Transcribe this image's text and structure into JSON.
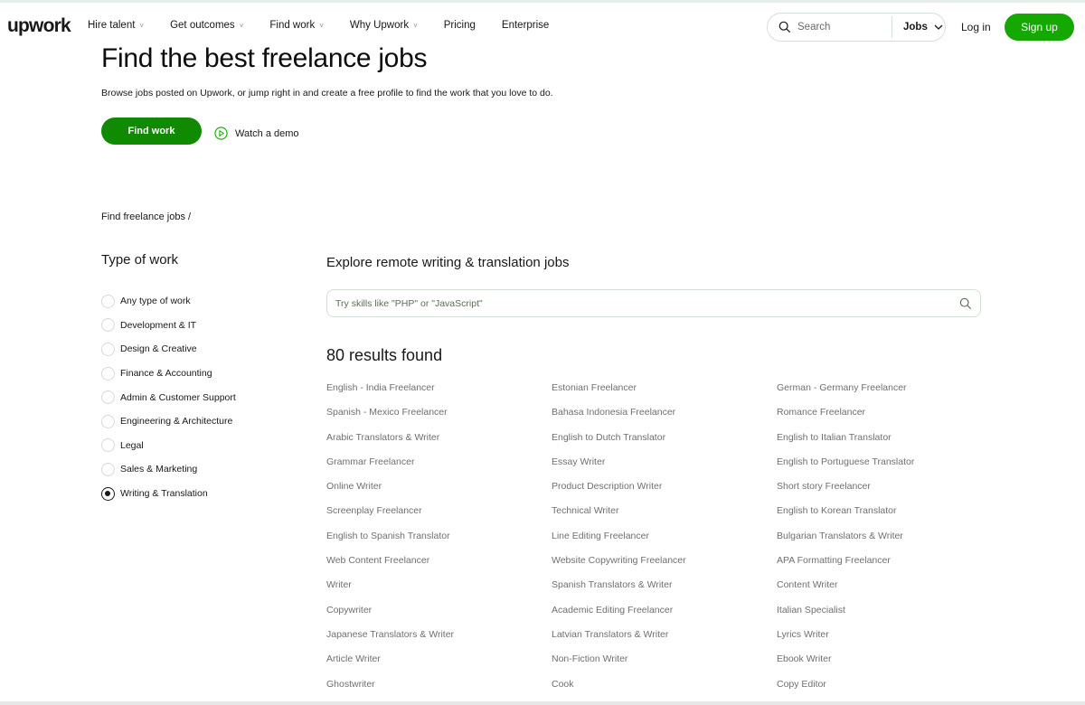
{
  "header": {
    "logo": "upwork",
    "nav": [
      {
        "label": "Hire talent",
        "dropdown": true
      },
      {
        "label": "Get outcomes",
        "dropdown": true
      },
      {
        "label": "Find work",
        "dropdown": true
      },
      {
        "label": "Why Upwork",
        "dropdown": true
      },
      {
        "label": "Pricing",
        "dropdown": false
      },
      {
        "label": "Enterprise",
        "dropdown": false
      }
    ],
    "search_placeholder": "Search",
    "search_scope": "Jobs",
    "login": "Log in",
    "signup": "Sign up"
  },
  "hero": {
    "title": "Find the best freelance jobs",
    "subtitle": "Browse jobs posted on Upwork, or jump right in and create a free profile to find the work that you love to do.",
    "find_work": "Find work",
    "watch_demo": "Watch a demo"
  },
  "breadcrumb": "Find freelance jobs /",
  "sidebar": {
    "title": "Type of work",
    "options": [
      {
        "label": "Any type of work",
        "selected": false
      },
      {
        "label": "Development & IT",
        "selected": false
      },
      {
        "label": "Design & Creative",
        "selected": false
      },
      {
        "label": "Finance & Accounting",
        "selected": false
      },
      {
        "label": "Admin & Customer Support",
        "selected": false
      },
      {
        "label": "Engineering & Architecture",
        "selected": false
      },
      {
        "label": "Legal",
        "selected": false
      },
      {
        "label": "Sales & Marketing",
        "selected": false
      },
      {
        "label": "Writing & Translation",
        "selected": true
      }
    ]
  },
  "main": {
    "title": "Explore remote writing & translation jobs",
    "skill_placeholder": "Try skills like \"PHP\" or \"JavaScript\"",
    "results": "80 results found",
    "jobs": [
      "English - India Freelancer",
      "Estonian Freelancer",
      "German - Germany Freelancer",
      "Spanish - Mexico Freelancer",
      "Bahasa Indonesia Freelancer",
      "Romance Freelancer",
      "Arabic Translators & Writer",
      "English to Dutch Translator",
      "English to Italian Translator",
      "Grammar Freelancer",
      "Essay Writer",
      "English to Portuguese Translator",
      "Online Writer",
      "Product Description Writer",
      "Short story Freelancer",
      "Screenplay Freelancer",
      "Technical Writer",
      "English to Korean Translator",
      "English to Spanish Translator",
      "Line Editing Freelancer",
      "Bulgarian Translators & Writer",
      "Web Content Freelancer",
      "Website Copywriting Freelancer",
      "APA Formatting Freelancer",
      "Writer",
      "Spanish Translators & Writer",
      "Content Writer",
      "Copywriter",
      "Academic Editing Freelancer",
      "Italian Specialist",
      "Japanese Translators & Writer",
      "Latvian Translators & Writer",
      "Lyrics Writer",
      "Article Writer",
      "Non-Fiction Writer",
      "Ebook Writer",
      "Ghostwriter",
      "Cook",
      "Copy Editor"
    ]
  },
  "colors": {
    "brand_green": "#14a800",
    "button_green": "#108a00"
  }
}
